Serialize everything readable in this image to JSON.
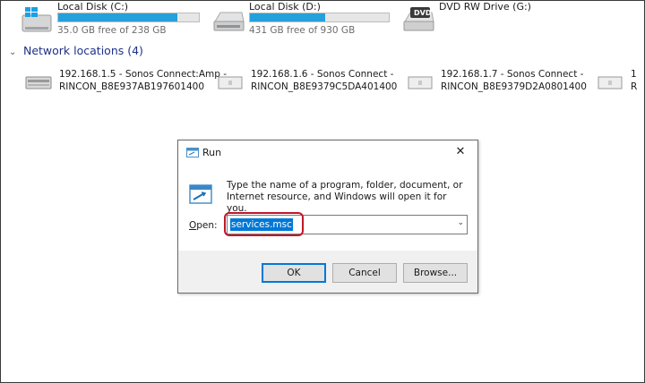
{
  "drives": [
    {
      "name": "Local Disk (C:)",
      "free_text": "35.0 GB free of 238 GB",
      "used_fraction": 0.85,
      "icon": "windows-drive-icon"
    },
    {
      "name": "Local Disk (D:)",
      "free_text": "431 GB free of 930 GB",
      "used_fraction": 0.54,
      "icon": "hard-drive-icon"
    },
    {
      "name": "DVD RW Drive (G:)",
      "icon": "dvd-drive-icon",
      "badge": "DVD"
    }
  ],
  "network_group": {
    "label": "Network locations (4)",
    "chevron": "chevron-down-icon"
  },
  "network_locations": [
    {
      "line1": "192.168.1.5 - Sonos Connect:Amp -",
      "line2": "RINCON_B8E937AB197601400"
    },
    {
      "line1": "192.168.1.6 - Sonos Connect -",
      "line2": "RINCON_B8E9379C5DA401400"
    },
    {
      "line1": "192.168.1.7 - Sonos Connect -",
      "line2": "RINCON_B8E9379D2A0801400"
    },
    {
      "line1": "1",
      "line2": "R"
    }
  ],
  "run_dialog": {
    "title": "Run",
    "close_glyph": "✕",
    "description": "Type the name of a program, folder, document, or Internet resource, and Windows will open it for you.",
    "open_label_accel": "O",
    "open_label_rest": "pen:",
    "open_value": "services.msc",
    "dropdown_glyph": "⌄",
    "buttons": {
      "ok": "OK",
      "cancel": "Cancel",
      "browse": "Browse..."
    }
  },
  "colors": {
    "accent": "#0078d7",
    "highlight_ring": "#c0182a",
    "progress": "#26a0da",
    "group_header": "#1e3287"
  }
}
